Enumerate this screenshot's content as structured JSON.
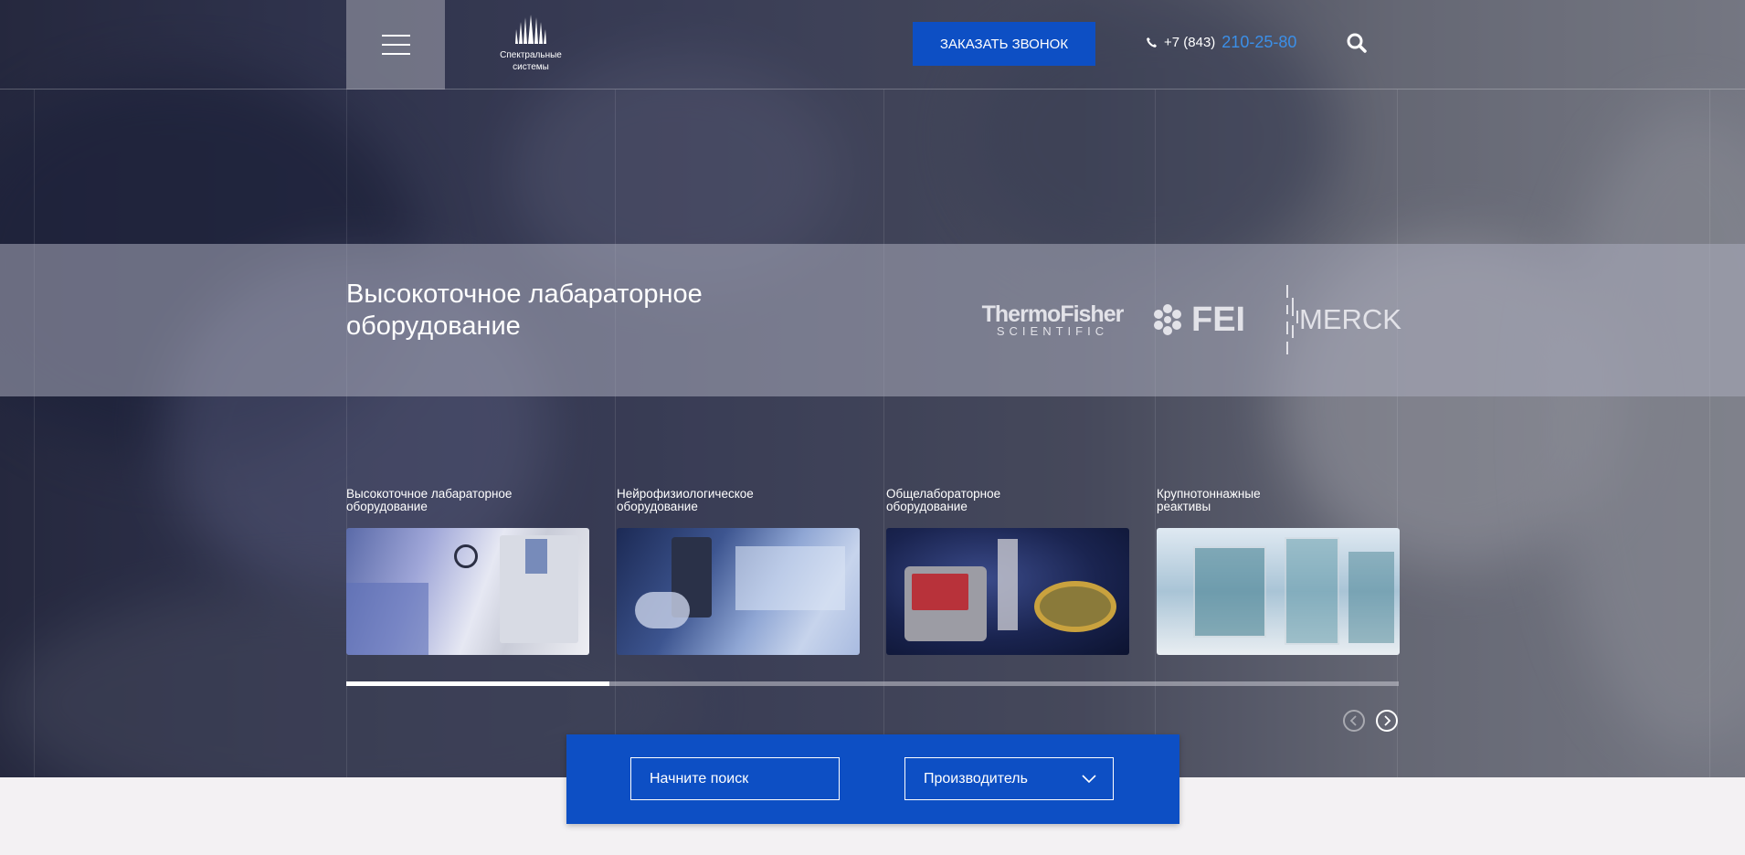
{
  "header": {
    "logo_text_line1": "Спектральные",
    "logo_text_line2": "системы",
    "callback_button": "ЗАКАЗАТЬ ЗВОНОК",
    "phone_prefix": "+7 (843)",
    "phone_number": "210-25-80"
  },
  "hero": {
    "title_line1": "Высокоточное лабараторное",
    "title_line2": "оборудование",
    "brands": {
      "thermo_line1": "ThermoFisher",
      "thermo_line2": "SCIENTIFIC",
      "fei": "FEI",
      "merck": "MERCK"
    }
  },
  "categories": [
    {
      "line1": "Высокоточное лабараторное",
      "line2": "оборудование"
    },
    {
      "line1": "Нейрофизиологическое",
      "line2": "оборудование"
    },
    {
      "line1": "Общелабораторное",
      "line2": "оборудование"
    },
    {
      "line1": "Крупнотоннажные",
      "line2": "реактивы"
    }
  ],
  "carousel": {
    "progress": 0.25
  },
  "search": {
    "placeholder": "Начните поиск",
    "manufacturer_label": "Производитель"
  },
  "colors": {
    "accent": "#0d4fc4",
    "phone_highlight": "#3b8fe8"
  },
  "icons": [
    "menu-icon",
    "logo-icon",
    "phone-icon",
    "search-icon",
    "chevron-left-icon",
    "chevron-right-icon",
    "chevron-down-icon"
  ]
}
